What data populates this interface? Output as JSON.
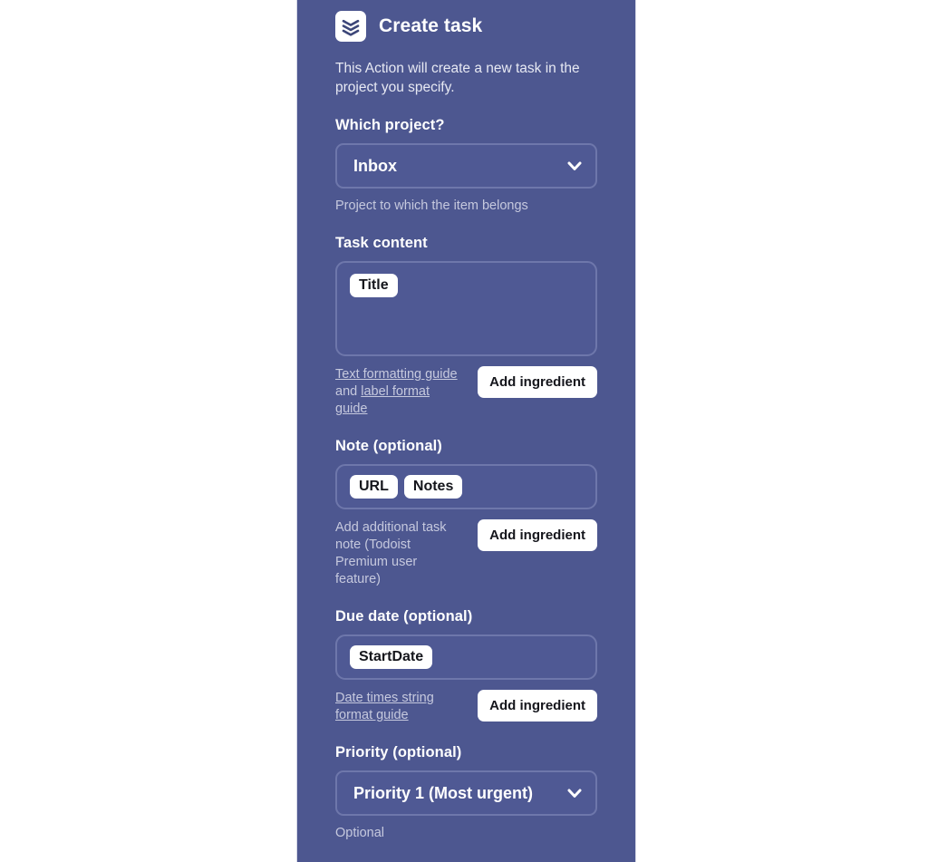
{
  "header": {
    "icon": "todoist-stack-icon",
    "title": "Create task"
  },
  "description": "This Action will create a new task in the project you specify.",
  "fields": {
    "project": {
      "label": "Which project?",
      "control": "select",
      "selected": "Inbox",
      "chevron_icon": "chevron-down-icon",
      "helper": "Project to which the item belongs"
    },
    "task_content": {
      "label": "Task content",
      "chips": [
        "Title"
      ],
      "links": {
        "link1": "Text formatting guide",
        "between": " and ",
        "link2": "label format guide"
      },
      "button": "Add ingredient"
    },
    "note": {
      "label": "Note (optional)",
      "chips": [
        "URL",
        "Notes"
      ],
      "helper": "Add additional task note (Todoist Premium user feature)",
      "button": "Add ingredient"
    },
    "due_date": {
      "label": "Due date (optional)",
      "chips": [
        "StartDate"
      ],
      "links": {
        "link1": "Date times string format guide"
      },
      "button": "Add ingredient"
    },
    "priority": {
      "label": "Priority (optional)",
      "control": "select",
      "selected": "Priority 1 (Most urgent)",
      "chevron_icon": "chevron-down-icon",
      "helper": "Optional"
    }
  },
  "colors": {
    "panel_background": "#4d5790",
    "field_background": "#4f5994",
    "field_border": "#6e77ab",
    "primary_text": "#ffffff",
    "muted_text": "#c6c9de",
    "chip_background": "#ffffff",
    "chip_text": "#15161c",
    "page_background": "#ffffff"
  }
}
